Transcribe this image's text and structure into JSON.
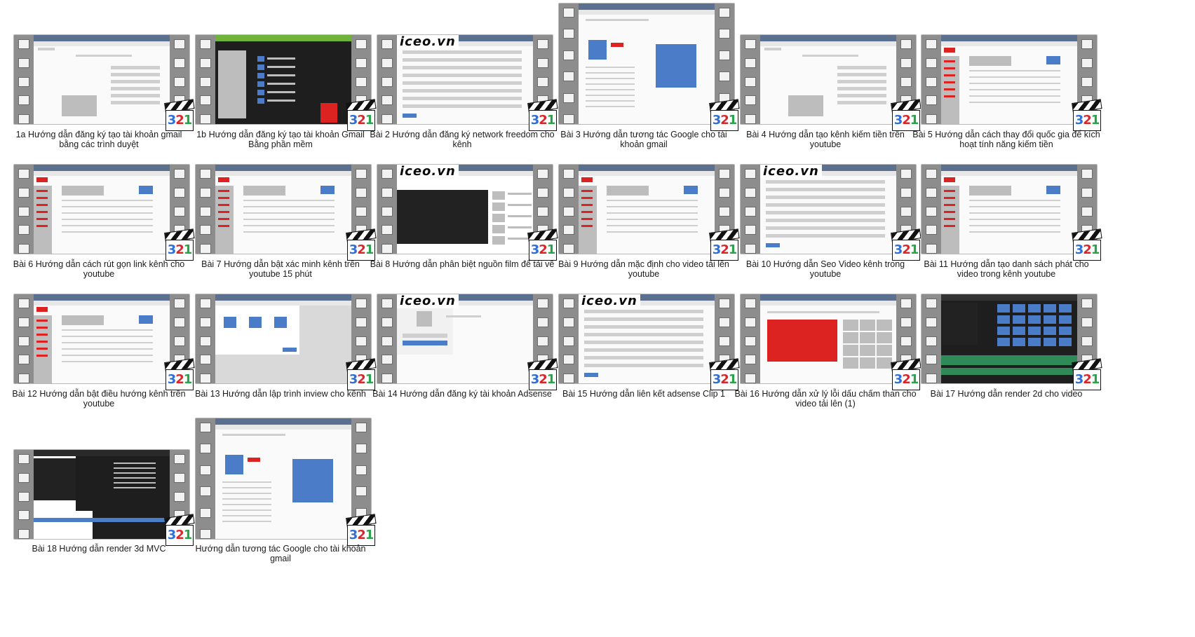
{
  "badge": {
    "d1": "3",
    "d2": "2",
    "d3": "1"
  },
  "items": [
    {
      "title": "1a Hướng dẫn đăng ký tạo tài khoản gmail bằng các trình duyệt",
      "style": "google"
    },
    {
      "title": "1b Hướng dẫn đăng ký  tạo tài khoản Gmail Bằng phần mềm",
      "style": "darkapp"
    },
    {
      "title": "Bài 2 Hướng dẫn đăng ký network freedom cho kênh",
      "style": "form",
      "watermark": "iceo.vn"
    },
    {
      "title": "Bài 3 Hướng dẫn tương tác Google cho tài khoản gmail",
      "style": "profile"
    },
    {
      "title": "Bài 4 Hướng dẫn tạo kênh kiếm tiền trên youtube",
      "style": "google"
    },
    {
      "title": "Bài 5 Hướng dẫn cách thay đổi quốc gia để kích hoạt tính năng kiếm tiền",
      "style": "youtube"
    },
    {
      "title": "Bài 6 Hướng dẫn cách rút gọn link kênh cho youtube",
      "style": "youtube"
    },
    {
      "title": "Bài 7 Hướng dẫn bật xác minh kênh trên youtube 15 phút",
      "style": "youtube"
    },
    {
      "title": "Bài 8 Hướng dẫn phân biệt nguồn film để tải về",
      "style": "video",
      "watermark": "iceo.vn"
    },
    {
      "title": "Bài 9 Hướng dẫn mặc định cho video tải lên youtube",
      "style": "youtube"
    },
    {
      "title": "Bài 10 Hướng dẫn Seo Video kênh trong youtube",
      "style": "form",
      "watermark": "iceo.vn"
    },
    {
      "title": "Bài 11 Hướng dẫn tạo danh sách phát cho video trong kênh youtube",
      "style": "youtube"
    },
    {
      "title": "Bài 12 Hướng dẫn bật điều hướng kênh trên youtube",
      "style": "youtube"
    },
    {
      "title": "Bài 13 Hướng dẫn lập trình inview cho kênh",
      "style": "dialog"
    },
    {
      "title": "Bài 14 Hướng dẫn đăng ký tài khoản Adsense",
      "style": "signin",
      "watermark": "iceo.vn"
    },
    {
      "title": "Bài 15 Hướng dẫn liên kết adsense Clip 1",
      "style": "form",
      "watermark": "iceo.vn"
    },
    {
      "title": "Bài 16 Hướng dẫn xử lý lỗi dấu chấm than cho video tải lên (1)",
      "style": "images"
    },
    {
      "title": "Bài 17 Hướng dẫn render 2d cho video",
      "style": "editor"
    },
    {
      "title": "Bài 18 Hướng dẫn render 3d MVC",
      "style": "render"
    },
    {
      "title": "Hướng dẫn tương tác Google cho tài khoản gmail",
      "style": "profile"
    }
  ]
}
